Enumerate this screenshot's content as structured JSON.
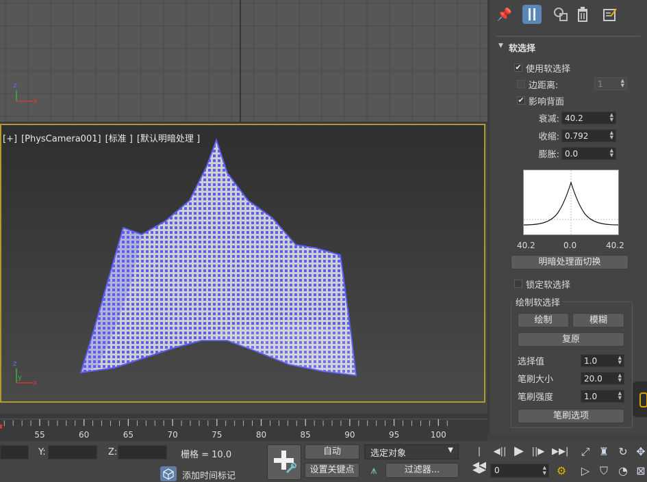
{
  "viewport_top": {
    "axis_labels": {
      "z": "z",
      "x": "x"
    }
  },
  "viewport_main": {
    "label": {
      "plus": "[+]",
      "camera": "[PhysCamera001]",
      "mode": "[标准 ]",
      "shading": "[默认明暗处理 ]"
    },
    "axis_labels": {
      "z": "z",
      "y": "y",
      "x": "x"
    }
  },
  "command_panel": {
    "toolbar_icons": [
      "pin-icon",
      "modifier-stack-icon",
      "objects-icon",
      "trash-icon",
      "configure-icon"
    ],
    "rollout": {
      "title": "软选择",
      "use_soft_selection": {
        "label": "使用软选择",
        "checked": true
      },
      "edge_distance": {
        "label": "边距离:",
        "checked": false,
        "value": "1"
      },
      "affect_backfacing": {
        "label": "影响背面",
        "checked": true
      },
      "falloff": {
        "label": "衰减:",
        "value": "40.2"
      },
      "pinch": {
        "label": "收缩:",
        "value": "0.792"
      },
      "bubble": {
        "label": "膨胀:",
        "value": "0.0"
      },
      "curve_labels": {
        "left": "40.2",
        "center": "0.0",
        "right": "40.2"
      },
      "shaded_face_toggle": "明暗处理面切换",
      "lock_soft_selection": {
        "label": "锁定软选择",
        "checked": false
      },
      "paint_group": {
        "title": "绘制软选择",
        "paint": "绘制",
        "blur": "模糊",
        "revert": "复原",
        "selection_value": {
          "label": "选择值",
          "value": "1.0"
        },
        "brush_size": {
          "label": "笔刷大小",
          "value": "20.0"
        },
        "brush_strength": {
          "label": "笔刷强度",
          "value": "1.0"
        },
        "brush_options": "笔刷选项"
      }
    }
  },
  "timeline": {
    "labels": [
      "55",
      "60",
      "65",
      "70",
      "75",
      "80",
      "85",
      "90",
      "95",
      "100"
    ]
  },
  "status_bar": {
    "x_value": "",
    "y_label": "Y:",
    "y_value": "",
    "z_label": "Z:",
    "z_value": "",
    "grid": "栅格 = 10.0",
    "add_time_tag": "添加时间标记",
    "auto_key": "自动",
    "set_key": "设置关键点",
    "selection_filter": "选定对象",
    "filters": "过滤器...",
    "frame_value": "0"
  },
  "colors": {
    "viewport_border": "#b8972f",
    "vertex_selected": "#5b5ef0",
    "mesh_fill": "#c9c9c9",
    "active_tool": "#5a86b8"
  }
}
